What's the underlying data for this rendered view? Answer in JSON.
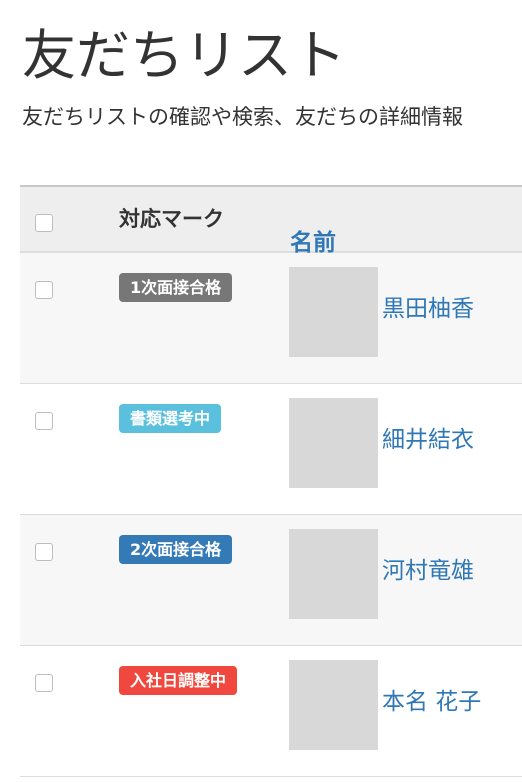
{
  "page": {
    "title": "友だちリスト",
    "description": "友だちリストの確認や検索、友だちの詳細情報"
  },
  "table": {
    "columns": {
      "mark": "対応マーク",
      "name": "名前"
    },
    "rows": [
      {
        "badge": "1次面接合格",
        "badge_color": "#777777",
        "name": "黒田柚香"
      },
      {
        "badge": "書類選考中",
        "badge_color": "#5bc0de",
        "name": "細井結衣"
      },
      {
        "badge": "2次面接合格",
        "badge_color": "#337ab7",
        "name": "河村竜雄"
      },
      {
        "badge": "入社日調整中",
        "badge_color": "#f0483e",
        "name": "本名 花子"
      }
    ]
  }
}
